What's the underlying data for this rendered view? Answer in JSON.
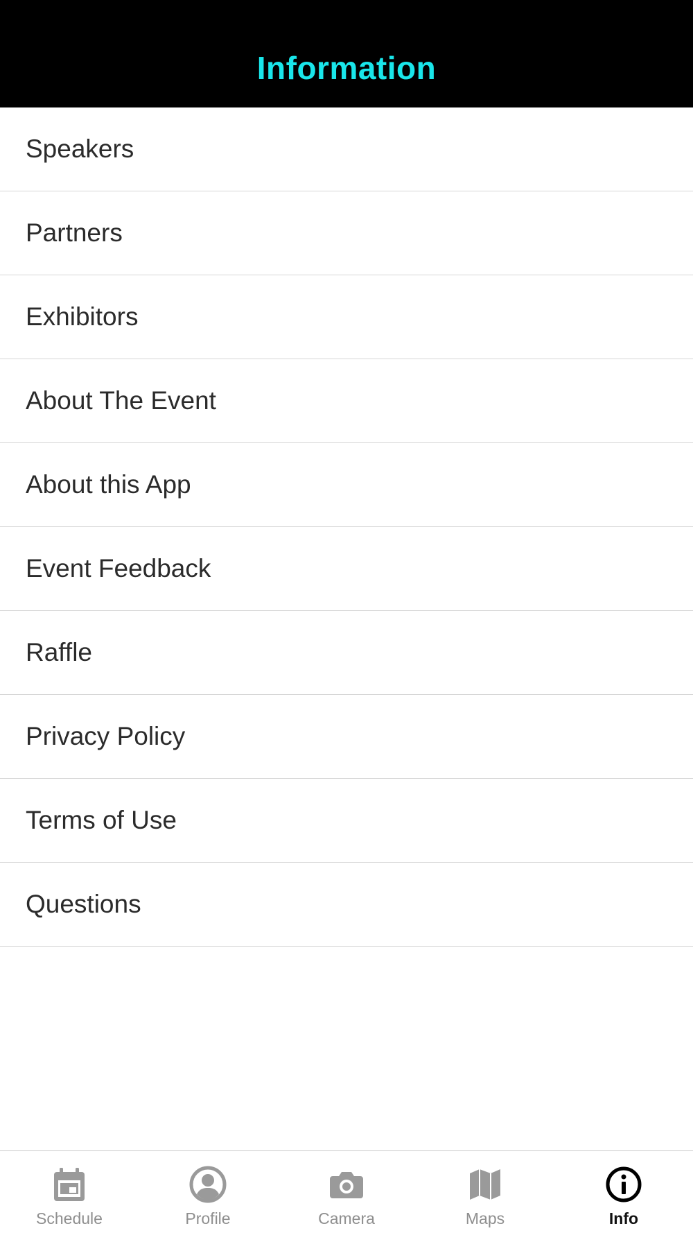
{
  "header": {
    "title": "Information",
    "title_color": "#19e6ea"
  },
  "menu": {
    "items": [
      {
        "label": "Speakers"
      },
      {
        "label": "Partners"
      },
      {
        "label": "Exhibitors"
      },
      {
        "label": "About The Event"
      },
      {
        "label": "About this App"
      },
      {
        "label": "Event Feedback"
      },
      {
        "label": "Raffle"
      },
      {
        "label": "Privacy Policy"
      },
      {
        "label": "Terms of Use"
      },
      {
        "label": "Questions"
      }
    ]
  },
  "tabbar": {
    "active": "Info",
    "inactive_color": "#9a9a9a",
    "active_color": "#000000",
    "tabs": [
      {
        "label": "Schedule",
        "icon": "calendar-icon"
      },
      {
        "label": "Profile",
        "icon": "person-circle-icon"
      },
      {
        "label": "Camera",
        "icon": "camera-icon"
      },
      {
        "label": "Maps",
        "icon": "map-icon"
      },
      {
        "label": "Info",
        "icon": "info-circle-icon"
      }
    ]
  }
}
